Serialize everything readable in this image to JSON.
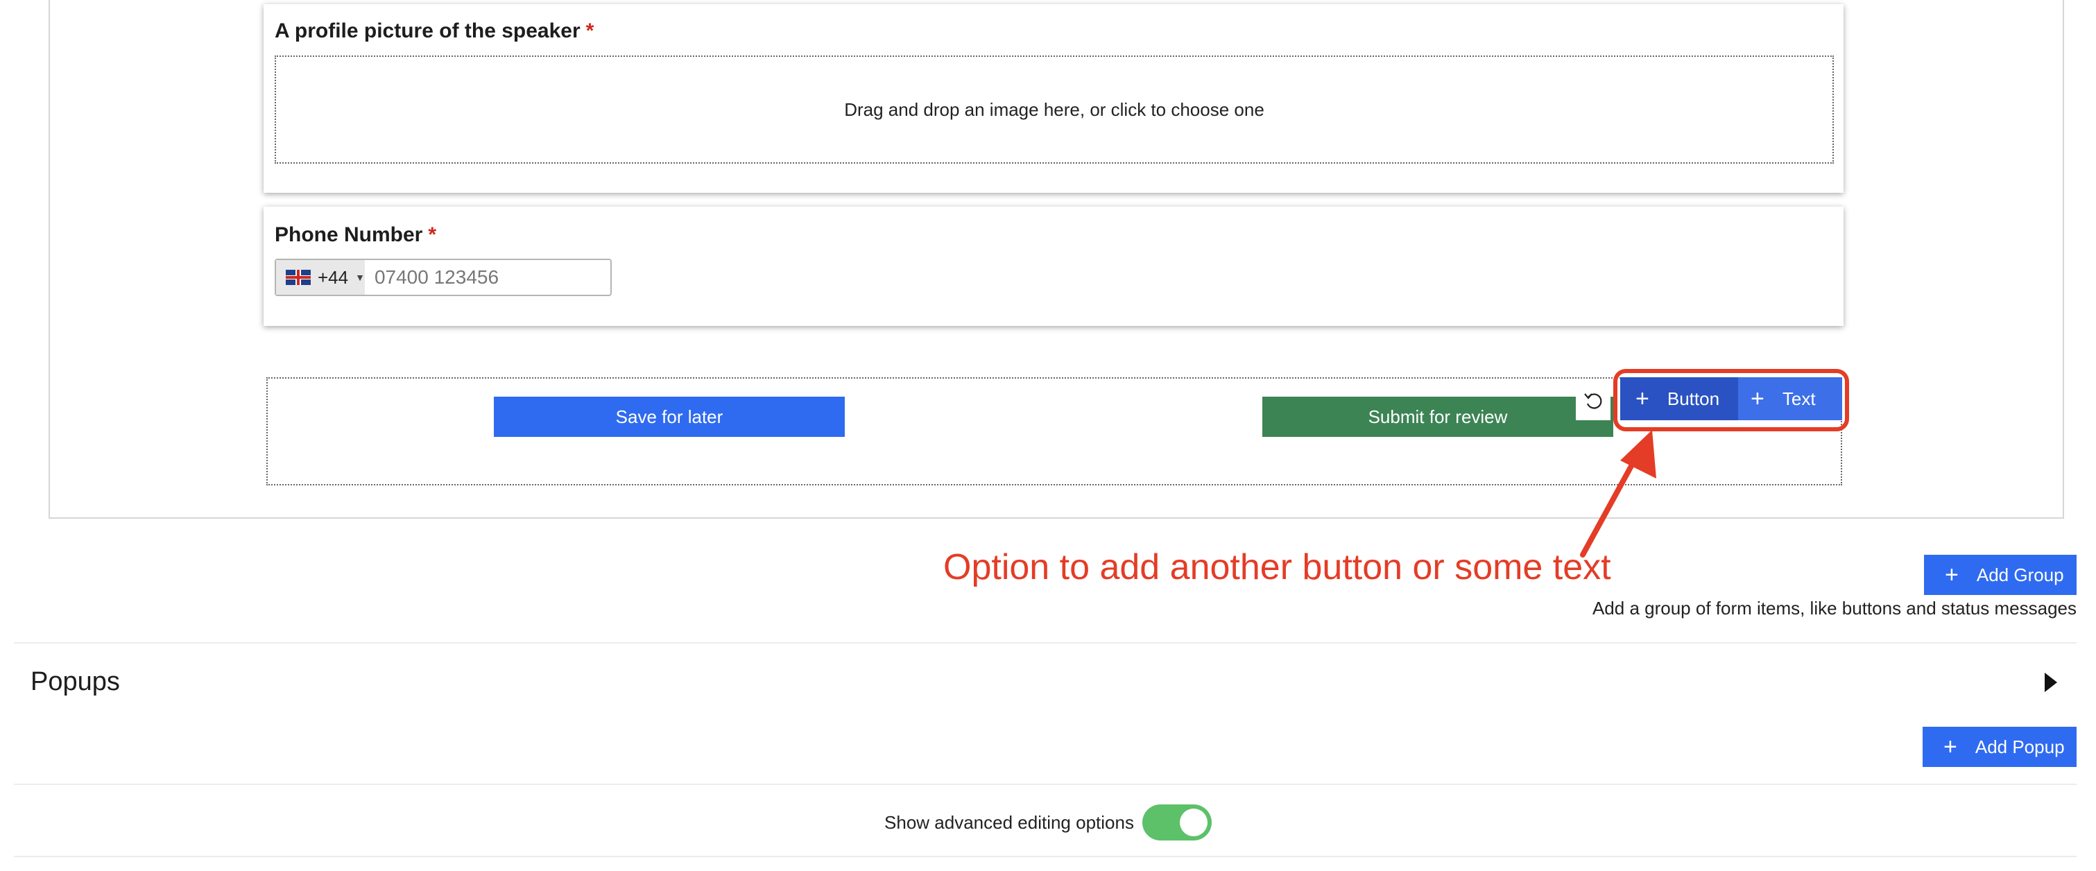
{
  "form": {
    "picture_field": {
      "label": "A profile picture of the speaker",
      "required_mark": "*",
      "dropzone_text": "Drag and drop an image here, or click to choose one"
    },
    "phone_field": {
      "label": "Phone Number",
      "required_mark": "*",
      "country_code": "+44",
      "country_flag_icon": "uk-flag-icon",
      "placeholder": "07400 123456",
      "value": ""
    },
    "actions": {
      "save_label": "Save for later",
      "submit_label": "Submit for review"
    },
    "group_toolbar": {
      "undo_icon": "undo-icon",
      "add_button_label": "Button",
      "add_text_label": "Text"
    }
  },
  "annotation": {
    "text": "Option to add another button or some text",
    "color": "#e43c26"
  },
  "groups": {
    "add_group_label": "Add Group",
    "help_text": "Add a group of form items, like buttons and status messages"
  },
  "popups": {
    "heading": "Popups",
    "add_popup_label": "Add Popup"
  },
  "advanced": {
    "label": "Show advanced editing options",
    "enabled": true
  },
  "colors": {
    "primary_blue": "#2f6bf0",
    "submit_green": "#3c8454",
    "toolbar_blue": "#2a55c9",
    "required_red": "#d0281c",
    "toggle_green": "#5cc168"
  }
}
